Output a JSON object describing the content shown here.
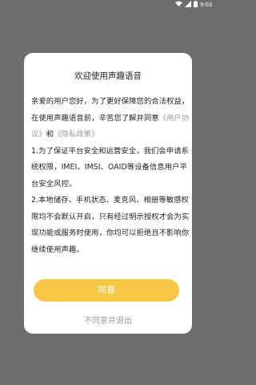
{
  "status_bar": {
    "time": "9:03",
    "wifi_icon": "wifi-icon",
    "signal_icon": "signal-icon",
    "battery_icon": "battery-icon"
  },
  "dialog": {
    "title": "欢迎使用声趣语音",
    "intro_before": "亲爱的用户您好，为了更好保障您的合法权益，在使用声趣语音前，辛苦您了解并同意",
    "user_agreement_link": "《用户协议》",
    "and_text": "和",
    "privacy_policy_link": "《隐私政策》",
    "point1": "1.为了保证平台安全和运营安全，我们会申请系统权限，IMEI、IMSI、OAID等设备信息用户平台安全风控。",
    "point2": "2.本地储存、手机状态、麦克风、相册等敏感权限均不会默认开启，只有经过明示授权才会为实现功能或服务时使用，你均可以拒绝且不影响你继续使用声趣。",
    "agree_label": "同意",
    "decline_label": "不同意并退出"
  },
  "colors": {
    "accent": "#f6c744",
    "link": "#9a9a9a",
    "overlay": "#6e6e6e"
  }
}
